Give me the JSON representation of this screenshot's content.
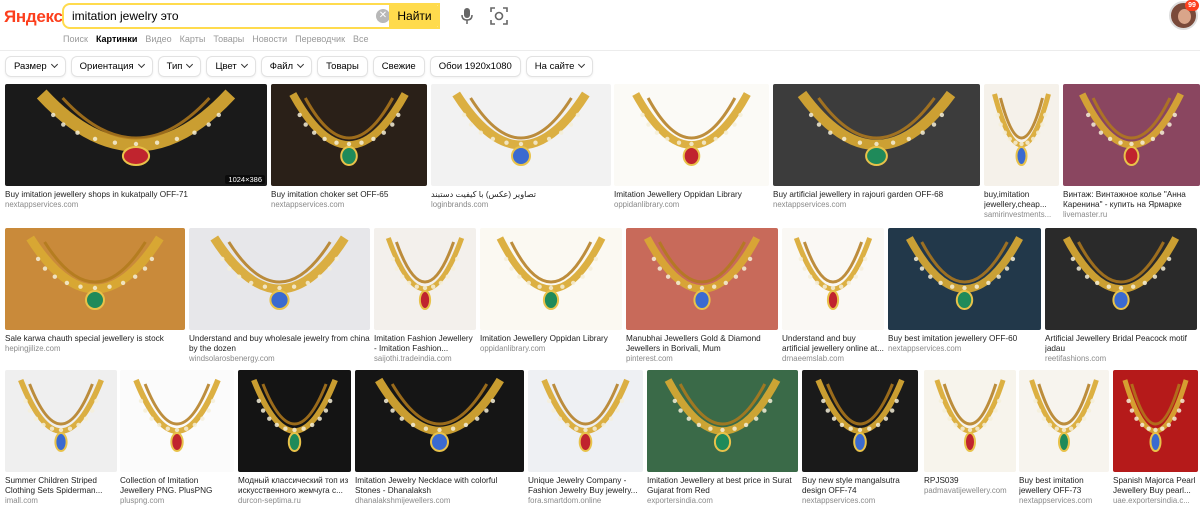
{
  "header": {
    "logo": "Яндекс",
    "search_value": "imitation jewelry это",
    "search_button": "Найти",
    "badge_count": "99"
  },
  "service_tabs": [
    "Поиск",
    "Картинки",
    "Видео",
    "Карты",
    "Товары",
    "Новости",
    "Переводчик",
    "Все"
  ],
  "filters": [
    {
      "label": "Размер",
      "dropdown": true
    },
    {
      "label": "Ориентация",
      "dropdown": true
    },
    {
      "label": "Тип",
      "dropdown": true
    },
    {
      "label": "Цвет",
      "dropdown": true
    },
    {
      "label": "Файл",
      "dropdown": true
    },
    {
      "label": "Товары",
      "dropdown": false
    },
    {
      "label": "Свежие",
      "dropdown": false
    },
    {
      "label": "Обои 1920x1080",
      "dropdown": false
    },
    {
      "label": "На сайте",
      "dropdown": true
    }
  ],
  "results": [
    [
      {
        "title": "Buy imitation jewellery shops in kukatpally OFF-71",
        "domain": "nextappservices.com",
        "size": "1024×386",
        "bg": "#1a1a1a"
      },
      {
        "title": "Buy imitation choker set OFF-65",
        "domain": "nextappservices.com",
        "bg": "#2a2018"
      },
      {
        "title": "تصاویر (عکس) با کیفیت دستبند",
        "domain": "loginbrands.com",
        "bg": "#f2f2f2"
      },
      {
        "title": "Imitation Jewellery Oppidan Library",
        "domain": "oppidanlibrary.com",
        "bg": "#fbfaf6"
      },
      {
        "title": "Buy artificial jewellery in rajouri garden OFF-68",
        "domain": "nextappservices.com",
        "bg": "#3c3c3c"
      },
      {
        "title": "buy,imitation jewellery,cheap...",
        "domain": "samirinvestments...",
        "bg": "#f5f1ea"
      },
      {
        "title": "Винтаж: Винтажное колье \"Анна Каренина\" - купить на Ярмарке",
        "domain": "livemaster.ru",
        "bg": "#8a4660"
      }
    ],
    [
      {
        "title": "Sale karwa chauth special jewellery is stock",
        "domain": "hepingjilize.com",
        "bg": "#c98a3a"
      },
      {
        "title": "Understand and buy wholesale jewelry from china by the dozen",
        "domain": "windsolarosbenergy.com",
        "bg": "#e7e7ea"
      },
      {
        "title": "Imitation Fashion Jewellery - Imitation Fashion...",
        "domain": "saijothi.tradeindia.com",
        "bg": "#f3f0ec"
      },
      {
        "title": "Imitation Jewellery Oppidan Library",
        "domain": "oppidanlibrary.com",
        "bg": "#fbf9f2"
      },
      {
        "title": "Manubhai Jewellers Gold & Diamond Jewellers in Borivali, Mum",
        "domain": "pinterest.com",
        "bg": "#c86a5a"
      },
      {
        "title": "Understand and buy artificial jewellery online at...",
        "domain": "drnaeemslab.com",
        "bg": "#faf8f4"
      },
      {
        "title": "Buy best imitation jewellery OFF-60",
        "domain": "nextappservices.com",
        "bg": "#22384a"
      },
      {
        "title": "Artificial Jewellery Bridal Peacock motif jadau",
        "domain": "reetifashions.com",
        "bg": "#2a2a2a"
      }
    ],
    [
      {
        "title": "Summer Children Striped Clothing Sets Spiderman...",
        "domain": "imall.com",
        "bg": "#efefef"
      },
      {
        "title": "Collection of Imitation Jewellery PNG. PlusPNG",
        "domain": "pluspng.com",
        "bg": "#fbfbfb"
      },
      {
        "title": "Модный классический топ из искусственного жемчуга с...",
        "domain": "durcon-septima.ru",
        "bg": "#141414"
      },
      {
        "title": "Imitation Jewelry Necklace with colorful Stones - Dhanalaksh",
        "domain": "dhanalakshmijewellers.com",
        "bg": "#151515"
      },
      {
        "title": "Unique Jewelry Company - Fashion Jewelry Buy jewelry...",
        "domain": "fora.smartdom.online",
        "bg": "#eef0f3"
      },
      {
        "title": "Imitation Jewellery at best price in Surat Gujarat from Red",
        "domain": "exportersindia.com",
        "bg": "#3a6a48"
      },
      {
        "title": "Buy new style mangalsutra design OFF-74",
        "domain": "nextappservices.com",
        "bg": "#1a1a1a"
      },
      {
        "title": "RPJS039",
        "domain": "padmavatijewellery.com",
        "bg": "#f7f4ec"
      },
      {
        "title": "Buy best imitation jewellery OFF-73",
        "domain": "nextappservices.com",
        "bg": "#f7f4ee"
      },
      {
        "title": "Spanish Majorca Pearl Jewellery Buy pearl...",
        "domain": "uae.exportersindia.c...",
        "bg": "#b51a1a"
      }
    ]
  ]
}
